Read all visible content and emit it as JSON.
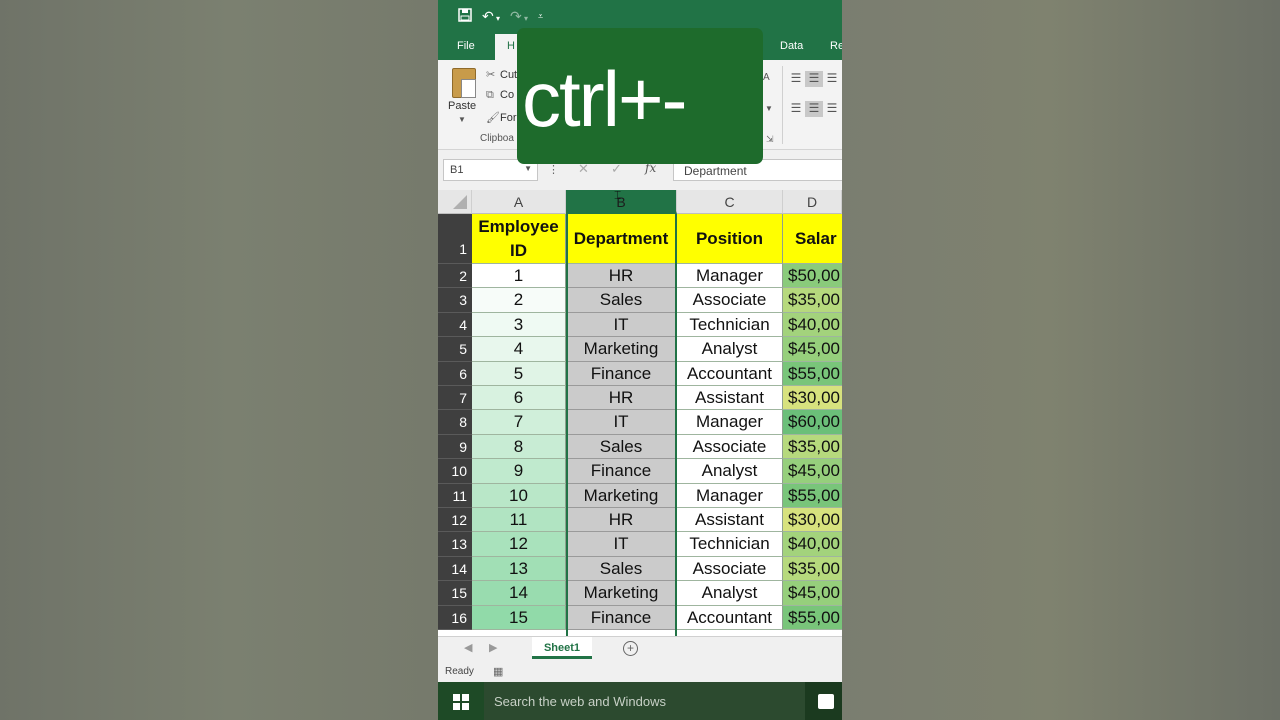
{
  "overlay_text": "ctrl+-",
  "qat": {
    "save_icon": "save-icon",
    "undo_icon": "undo-icon",
    "redo_icon": "redo-icon",
    "customize_icon": "customize-icon"
  },
  "tabs": {
    "file": "File",
    "home_partial": "H",
    "data": "Data",
    "review_partial": "Re"
  },
  "ribbon": {
    "paste": "Paste",
    "cut": "Cut",
    "copy": "Co",
    "format_painter": "For",
    "clipboard_group": "Clipboa",
    "font_size_partial": "A"
  },
  "formula_bar": {
    "name_box": "B1",
    "content": "Department",
    "fx": "fx"
  },
  "columns": [
    {
      "letter": "A",
      "selected": false
    },
    {
      "letter": "B",
      "selected": true
    },
    {
      "letter": "C",
      "selected": false
    },
    {
      "letter": "D",
      "selected": false
    }
  ],
  "header_row": {
    "row_number": "1",
    "A": "Employee ID",
    "B": "Department",
    "C": "Position",
    "D": "Salar"
  },
  "rows": [
    {
      "n": "2",
      "A": "1",
      "B": "HR",
      "C": "Manager",
      "D": "$50,00"
    },
    {
      "n": "3",
      "A": "2",
      "B": "Sales",
      "C": "Associate",
      "D": "$35,00"
    },
    {
      "n": "4",
      "A": "3",
      "B": "IT",
      "C": "Technician",
      "D": "$40,00"
    },
    {
      "n": "5",
      "A": "4",
      "B": "Marketing",
      "C": "Analyst",
      "D": "$45,00"
    },
    {
      "n": "6",
      "A": "5",
      "B": "Finance",
      "C": "Accountant",
      "D": "$55,00"
    },
    {
      "n": "7",
      "A": "6",
      "B": "HR",
      "C": "Assistant",
      "D": "$30,00"
    },
    {
      "n": "8",
      "A": "7",
      "B": "IT",
      "C": "Manager",
      "D": "$60,00"
    },
    {
      "n": "9",
      "A": "8",
      "B": "Sales",
      "C": "Associate",
      "D": "$35,00"
    },
    {
      "n": "10",
      "A": "9",
      "B": "Finance",
      "C": "Analyst",
      "D": "$45,00"
    },
    {
      "n": "11",
      "A": "10",
      "B": "Marketing",
      "C": "Manager",
      "D": "$55,00"
    },
    {
      "n": "12",
      "A": "11",
      "B": "HR",
      "C": "Assistant",
      "D": "$30,00"
    },
    {
      "n": "13",
      "A": "12",
      "B": "IT",
      "C": "Technician",
      "D": "$40,00"
    },
    {
      "n": "14",
      "A": "13",
      "B": "Sales",
      "C": "Associate",
      "D": "$35,00"
    },
    {
      "n": "15",
      "A": "14",
      "B": "Marketing",
      "C": "Analyst",
      "D": "$45,00"
    },
    {
      "n": "16",
      "A": "15",
      "B": "Finance",
      "C": "Accountant",
      "D": "$55,00"
    }
  ],
  "sheet_tabs": [
    "Sheet1"
  ],
  "status": {
    "ready": "Ready"
  },
  "taskbar": {
    "search_placeholder": "Search the web and Windows"
  },
  "colors": {
    "excel_green": "#217346",
    "header_fill": "#ffff00",
    "dept_column_fill": "#cbcbcb",
    "overlay_green": "#1e6b2c"
  }
}
